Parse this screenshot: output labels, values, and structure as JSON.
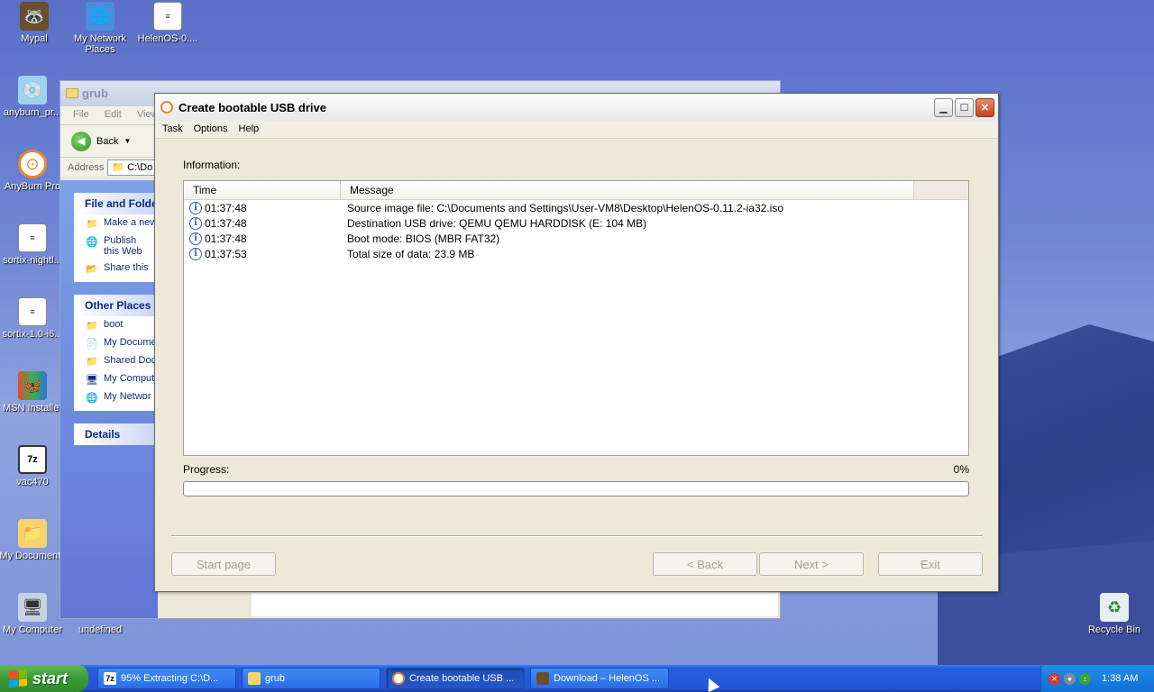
{
  "desktop": {
    "icons": [
      {
        "label": "Mypal",
        "glyph": "🦝"
      },
      {
        "label": "My Network Places",
        "glyph": "🌐"
      },
      {
        "label": "HelenOS-0....",
        "glyph": "≡"
      },
      {
        "label": "anyburn_pr...",
        "glyph": "💿"
      },
      {
        "label": "AnyBurn Pro",
        "glyph": "⊙"
      },
      {
        "label": "sortix-nightl...",
        "glyph": "≡"
      },
      {
        "label": "sortix-1.0-i6...",
        "glyph": "≡"
      },
      {
        "label": "MSN Installer",
        "glyph": "🦋"
      },
      {
        "label": "vac470",
        "glyph": "7z"
      },
      {
        "label": "My Documents",
        "glyph": "📁"
      },
      {
        "label": "My Computer",
        "glyph": "🖥"
      },
      {
        "label": "undefined",
        "glyph": ""
      },
      {
        "label": "Recycle Bin",
        "glyph": "♻"
      }
    ]
  },
  "explorer": {
    "title": "grub",
    "menu": [
      "File",
      "Edit",
      "View"
    ],
    "back_label": "Back",
    "address_label": "Address",
    "address_value": "C:\\Do",
    "file_tasks": {
      "header": "File and Folde",
      "items": [
        "Make a new",
        "Publish this Web",
        "Share this"
      ]
    },
    "other_places": {
      "header": "Other Places",
      "items": [
        "boot",
        "My Docume",
        "Shared Doc",
        "My Comput",
        "My Networ"
      ]
    },
    "details_header": "Details"
  },
  "dialog": {
    "title": "Create bootable USB drive",
    "menu": [
      "Task",
      "Options",
      "Help"
    ],
    "info_label": "Information:",
    "columns": [
      "Time",
      "Message"
    ],
    "log": [
      {
        "time": "01:37:48",
        "message": "Source image file: C:\\Documents and Settings\\User-VM8\\Desktop\\HelenOS-0.11.2-ia32.iso"
      },
      {
        "time": "01:37:48",
        "message": "Destination USB drive: QEMU QEMU HARDDISK (E:  104 MB)"
      },
      {
        "time": "01:37:48",
        "message": "Boot mode: BIOS (MBR FAT32)"
      },
      {
        "time": "01:37:53",
        "message": "Total size of data: 23.9 MB"
      }
    ],
    "progress_label": "Progress:",
    "progress_value": 0,
    "progress_text": "0%",
    "buttons": {
      "start_page": "Start page",
      "back": "< Back",
      "next": "Next >",
      "exit": "Exit"
    }
  },
  "taskbar": {
    "start_label": "start",
    "tasks": [
      {
        "label": "95% Extracting C:\\D...",
        "icon": "7z"
      },
      {
        "label": "grub",
        "icon": "folder"
      },
      {
        "label": "Create bootable USB ...",
        "icon": "anyburn",
        "active": true
      },
      {
        "label": "Download – HelenOS ...",
        "icon": "mypal"
      }
    ],
    "clock": "1:38 AM"
  }
}
